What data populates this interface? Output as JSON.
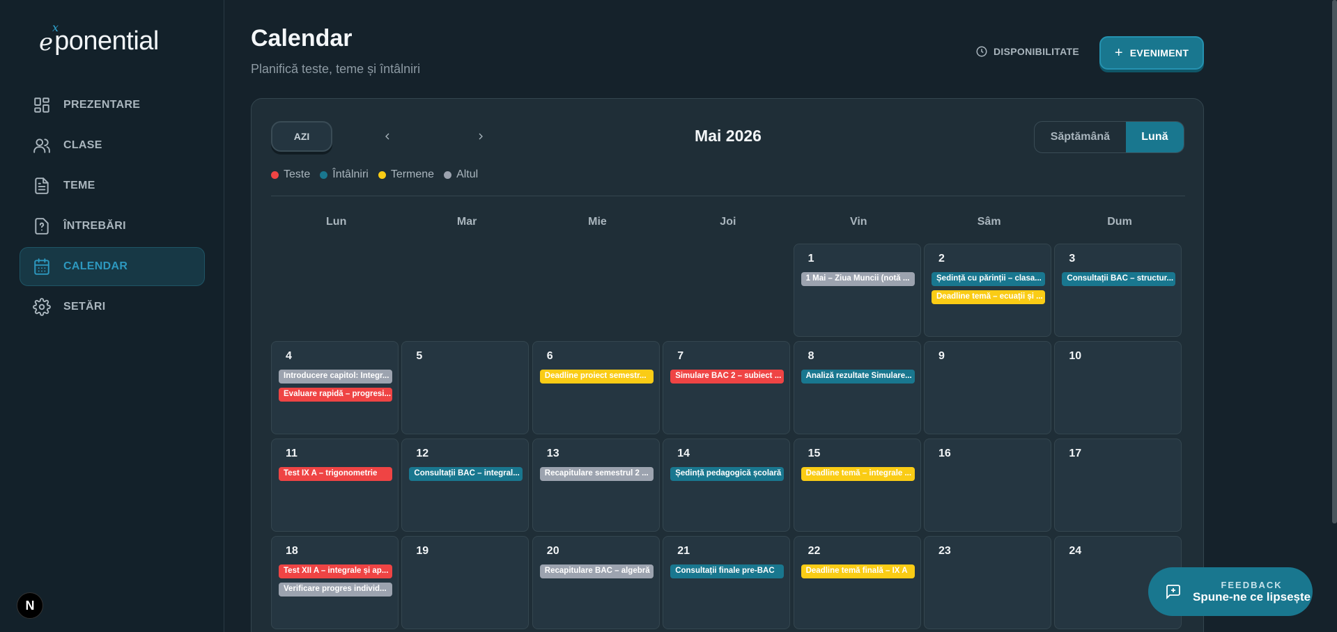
{
  "brand": {
    "logo_e": "e",
    "logo_x": "x",
    "logo_rest": "ponential"
  },
  "sidebar": {
    "items": [
      {
        "label": "PREZENTARE",
        "icon": "dashboard-icon",
        "active": false
      },
      {
        "label": "CLASE",
        "icon": "users-icon",
        "active": false
      },
      {
        "label": "TEME",
        "icon": "document-icon",
        "active": false
      },
      {
        "label": "ÎNTREBĂRI",
        "icon": "question-icon",
        "active": false
      },
      {
        "label": "CALENDAR",
        "icon": "calendar-icon",
        "active": true
      },
      {
        "label": "SETĂRI",
        "icon": "gear-icon",
        "active": false
      }
    ],
    "bottom_badge": "N"
  },
  "header": {
    "title": "Calendar",
    "subtitle": "Planifică teste, teme și întâlniri",
    "availability_label": "DISPONIBILITATE",
    "event_label": "EVENIMENT"
  },
  "calendar": {
    "today_label": "AZI",
    "month_title": "Mai 2026",
    "view_week": "Săptămână",
    "view_month": "Lună",
    "legend": [
      {
        "label": "Teste",
        "color": "#ef4444"
      },
      {
        "label": "Întâlniri",
        "color": "#19778f"
      },
      {
        "label": "Termene",
        "color": "#facc15"
      },
      {
        "label": "Altul",
        "color": "#9ca3af"
      }
    ],
    "weekdays": [
      "Lun",
      "Mar",
      "Mie",
      "Joi",
      "Vin",
      "Sâm",
      "Dum"
    ],
    "colors": {
      "test": "#ef4444",
      "meeting": "#19778f",
      "deadline": "#facc15",
      "other": "#9ca3af"
    },
    "weeks": [
      [
        null,
        null,
        null,
        null,
        {
          "day": "1",
          "events": [
            {
              "text": "1 Mai – Ziua Muncii (notă ...",
              "type": "other"
            }
          ]
        },
        {
          "day": "2",
          "events": [
            {
              "text": "Ședință cu părinții – clasa...",
              "type": "meeting"
            },
            {
              "text": "Deadline temă – ecuații și ...",
              "type": "deadline"
            }
          ]
        },
        {
          "day": "3",
          "events": [
            {
              "text": "Consultații BAC – structur...",
              "type": "meeting"
            }
          ]
        }
      ],
      [
        {
          "day": "4",
          "events": [
            {
              "text": "Introducere capitol: Integr...",
              "type": "other"
            },
            {
              "text": "Evaluare rapidă – progresi...",
              "type": "test"
            }
          ]
        },
        {
          "day": "5",
          "events": []
        },
        {
          "day": "6",
          "events": [
            {
              "text": "Deadline proiect semestr...",
              "type": "deadline"
            }
          ]
        },
        {
          "day": "7",
          "events": [
            {
              "text": "Simulare BAC 2 – subiect ...",
              "type": "test"
            }
          ]
        },
        {
          "day": "8",
          "events": [
            {
              "text": "Analiză rezultate Simulare...",
              "type": "meeting"
            }
          ]
        },
        {
          "day": "9",
          "events": []
        },
        {
          "day": "10",
          "events": []
        }
      ],
      [
        {
          "day": "11",
          "events": [
            {
              "text": "Test IX A – trigonometrie",
              "type": "test"
            }
          ]
        },
        {
          "day": "12",
          "events": [
            {
              "text": "Consultații BAC – integral...",
              "type": "meeting"
            }
          ]
        },
        {
          "day": "13",
          "events": [
            {
              "text": "Recapitulare semestrul 2 ...",
              "type": "other"
            }
          ]
        },
        {
          "day": "14",
          "events": [
            {
              "text": "Ședință pedagogică școlară",
              "type": "meeting"
            }
          ]
        },
        {
          "day": "15",
          "events": [
            {
              "text": "Deadline temă – integrale ...",
              "type": "deadline"
            }
          ]
        },
        {
          "day": "16",
          "events": []
        },
        {
          "day": "17",
          "events": []
        }
      ],
      [
        {
          "day": "18",
          "events": [
            {
              "text": "Test XII A – integrale și ap...",
              "type": "test"
            },
            {
              "text": "Verificare progres individ...",
              "type": "other"
            }
          ]
        },
        {
          "day": "19",
          "events": []
        },
        {
          "day": "20",
          "events": [
            {
              "text": "Recapitulare BAC – algebră",
              "type": "other"
            }
          ]
        },
        {
          "day": "21",
          "events": [
            {
              "text": "Consultații finale pre-BAC",
              "type": "meeting"
            }
          ]
        },
        {
          "day": "22",
          "events": [
            {
              "text": "Deadline temă finală – IX A",
              "type": "deadline"
            }
          ]
        },
        {
          "day": "23",
          "events": []
        },
        {
          "day": "24",
          "events": []
        }
      ]
    ]
  },
  "feedback": {
    "small": "FEEDBACK",
    "big": "Spune-ne ce lipsește"
  }
}
